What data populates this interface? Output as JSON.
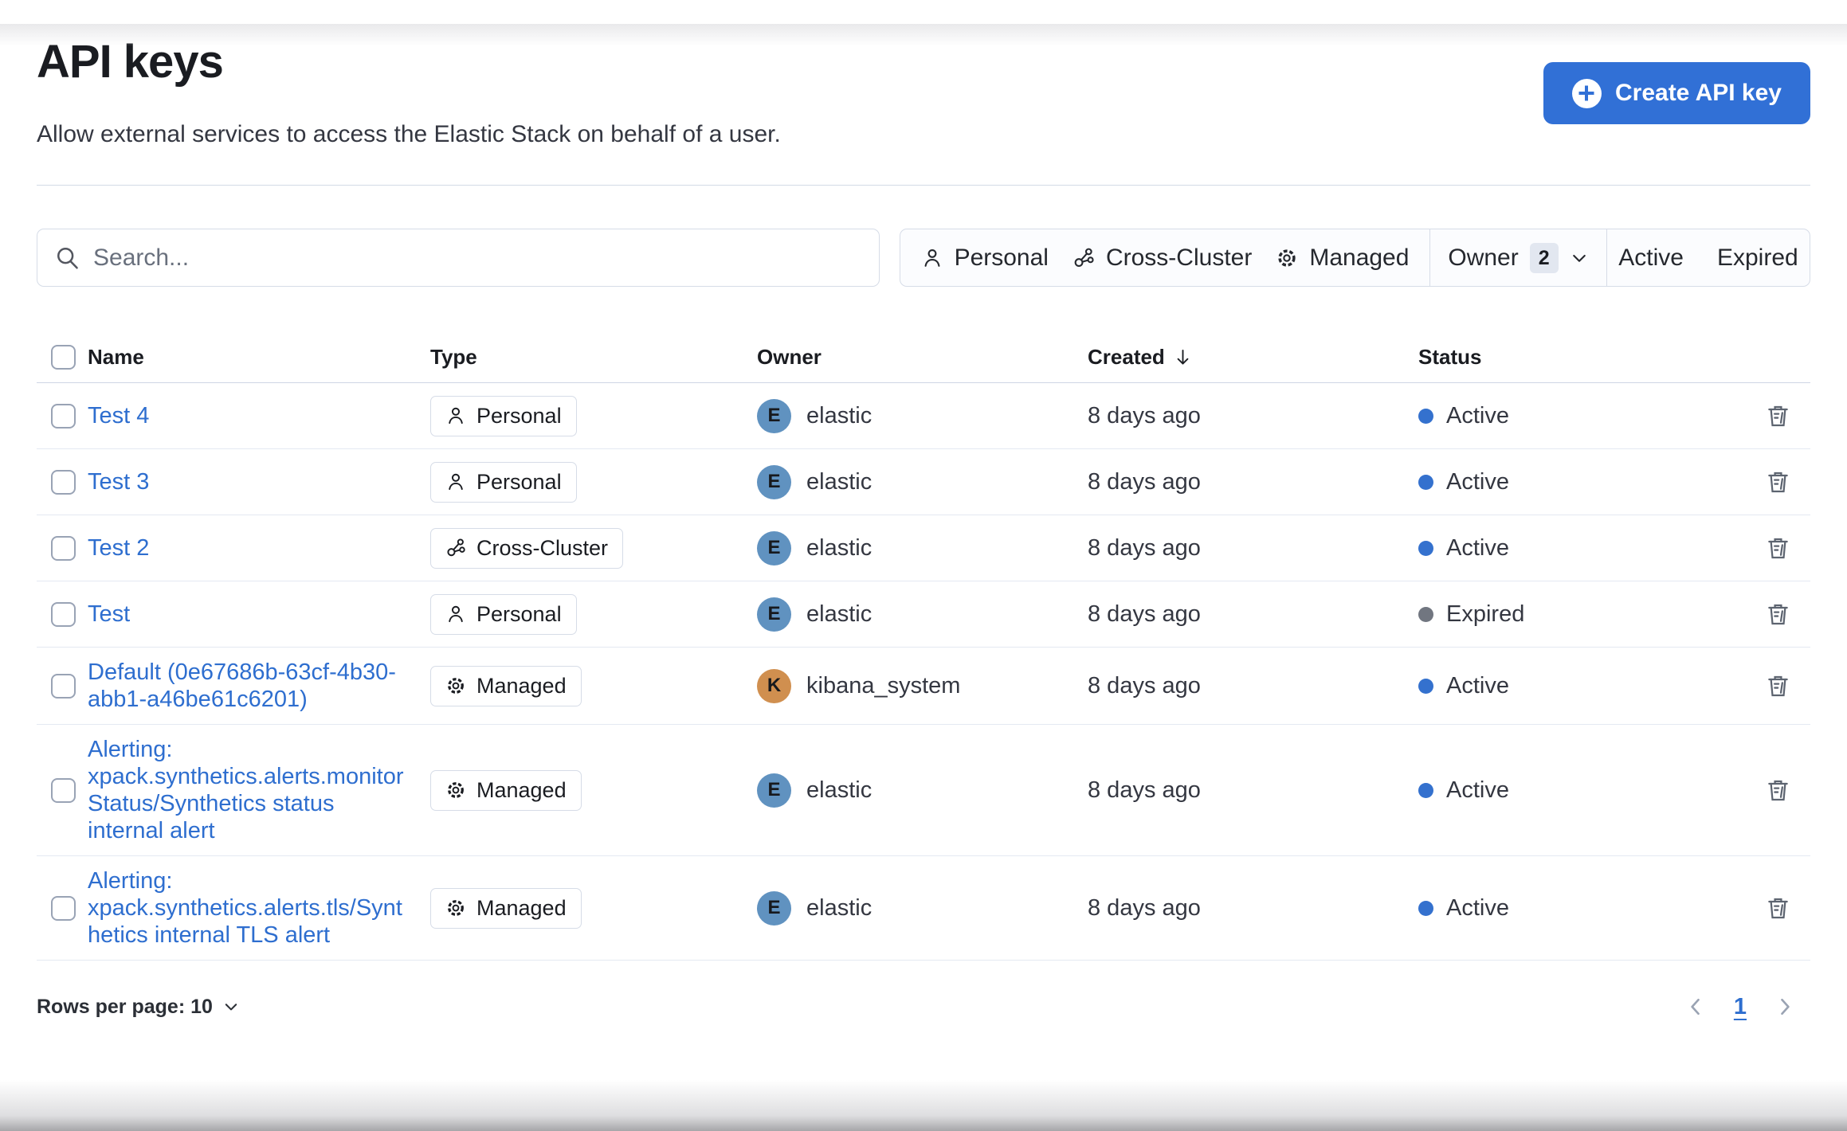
{
  "page": {
    "title": "API keys",
    "subtitle": "Allow external services to access the Elastic Stack on behalf of a user.",
    "create_button_label": "Create API key"
  },
  "search": {
    "placeholder": "Search..."
  },
  "filters": {
    "personal_label": "Personal",
    "cross_cluster_label": "Cross-Cluster",
    "managed_label": "Managed",
    "owner_label": "Owner",
    "owner_count": "2",
    "active_label": "Active",
    "expired_label": "Expired"
  },
  "table": {
    "columns": {
      "name": "Name",
      "type": "Type",
      "owner": "Owner",
      "created": "Created",
      "status": "Status"
    },
    "sorted_column": "created",
    "rows": [
      {
        "name": "Test 4",
        "type": "Personal",
        "type_kind": "personal",
        "owner": "elastic",
        "avatar_initial": "E",
        "avatar_color": "#6092C0",
        "created": "8 days ago",
        "status": "Active",
        "status_kind": "active"
      },
      {
        "name": "Test 3",
        "type": "Personal",
        "type_kind": "personal",
        "owner": "elastic",
        "avatar_initial": "E",
        "avatar_color": "#6092C0",
        "created": "8 days ago",
        "status": "Active",
        "status_kind": "active"
      },
      {
        "name": "Test 2",
        "type": "Cross-Cluster",
        "type_kind": "cross_cluster",
        "owner": "elastic",
        "avatar_initial": "E",
        "avatar_color": "#6092C0",
        "created": "8 days ago",
        "status": "Active",
        "status_kind": "active"
      },
      {
        "name": "Test",
        "type": "Personal",
        "type_kind": "personal",
        "owner": "elastic",
        "avatar_initial": "E",
        "avatar_color": "#6092C0",
        "created": "8 days ago",
        "status": "Expired",
        "status_kind": "expired"
      },
      {
        "name": "Default (0e67686b-63cf-4b30-abb1-a46be61c6201)",
        "type": "Managed",
        "type_kind": "managed",
        "owner": "kibana_system",
        "avatar_initial": "K",
        "avatar_color": "#D08F4F",
        "created": "8 days ago",
        "status": "Active",
        "status_kind": "active"
      },
      {
        "name": "Alerting: xpack.synthetics.alerts.monitorStatus/Synthetics status internal alert",
        "type": "Managed",
        "type_kind": "managed",
        "owner": "elastic",
        "avatar_initial": "E",
        "avatar_color": "#6092C0",
        "created": "8 days ago",
        "status": "Active",
        "status_kind": "active"
      },
      {
        "name": "Alerting: xpack.synthetics.alerts.tls/Synthetics internal TLS alert",
        "type": "Managed",
        "type_kind": "managed",
        "owner": "elastic",
        "avatar_initial": "E",
        "avatar_color": "#6092C0",
        "created": "8 days ago",
        "status": "Active",
        "status_kind": "active"
      }
    ]
  },
  "pagination": {
    "rows_per_page_label": "Rows per page: 10",
    "current_page": "1"
  },
  "colors": {
    "primary_button": "#3170D6",
    "link": "#2E6ECF",
    "active_dot": "#3471CE",
    "expired_dot": "#717680",
    "avatar_elastic": "#6092C0",
    "avatar_kibana_system": "#D08F4F"
  }
}
